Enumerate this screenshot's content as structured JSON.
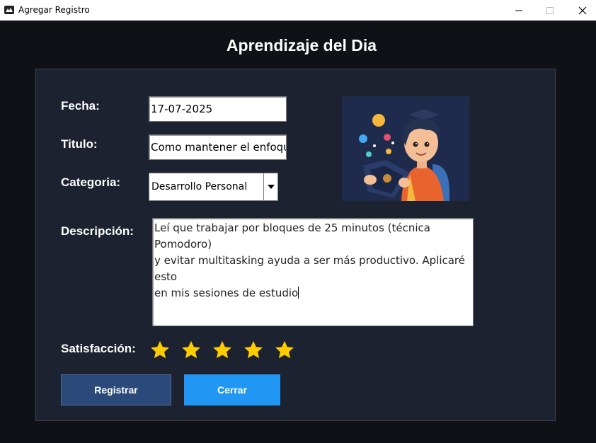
{
  "window": {
    "title": "Agregar Registro"
  },
  "heading": "Aprendizaje del Dia",
  "form": {
    "fecha_label": "Fecha:",
    "fecha_value": "17-07-2025",
    "titulo_label": "Titulo:",
    "titulo_value": "Como mantener el enfoque",
    "categoria_label": "Categoria:",
    "categoria_value": "Desarrollo Personal",
    "descripcion_label": "Descripción:",
    "descripcion_lines": [
      "Leí que trabajar por bloques de 25 minutos (técnica Pomodoro)",
      "y evitar multitasking ayuda a ser más productivo. Aplicaré esto",
      "en mis sesiones de estudio"
    ],
    "satisfaccion_label": "Satisfacción:",
    "satisfaccion_rating": 5,
    "satisfaccion_max": 5
  },
  "buttons": {
    "register": "Registrar",
    "close": "Cerrar"
  },
  "colors": {
    "background": "#0f1117",
    "card": "#1c2230",
    "star": "#ffcc00",
    "register_button": "#2b4a7a",
    "close_button": "#2196f3"
  },
  "icons": {
    "app": "app-icon",
    "minimize": "minimize-icon",
    "maximize": "maximize-icon",
    "close": "close-icon",
    "dropdown": "chevron-down-icon",
    "star": "star-icon",
    "illustration": "student-reading-illustration"
  }
}
